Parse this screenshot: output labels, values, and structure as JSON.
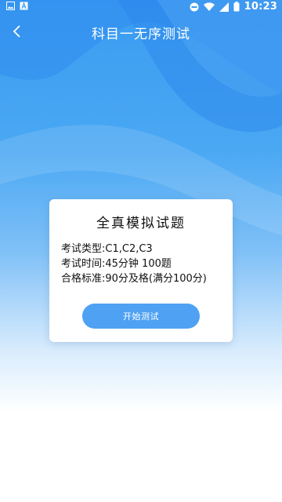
{
  "status_bar": {
    "time": "10:23",
    "left_icons": [
      "image-icon",
      "text-a-icon"
    ],
    "right_icons": [
      "do-not-disturb-icon",
      "wifi-icon",
      "signal-icon",
      "battery-icon"
    ]
  },
  "header": {
    "title": "科目一无序测试",
    "back_icon": "chevron-left-icon"
  },
  "card": {
    "title": "全真模拟试题",
    "rows": [
      "考试类型:C1,C2,C3",
      "考试时间:45分钟 100题",
      "合格标准:90分及格(满分100分)"
    ],
    "start_button": "开始测试"
  },
  "colors": {
    "accent": "#4ea1f3",
    "header_blue": "#3a9cf2"
  }
}
